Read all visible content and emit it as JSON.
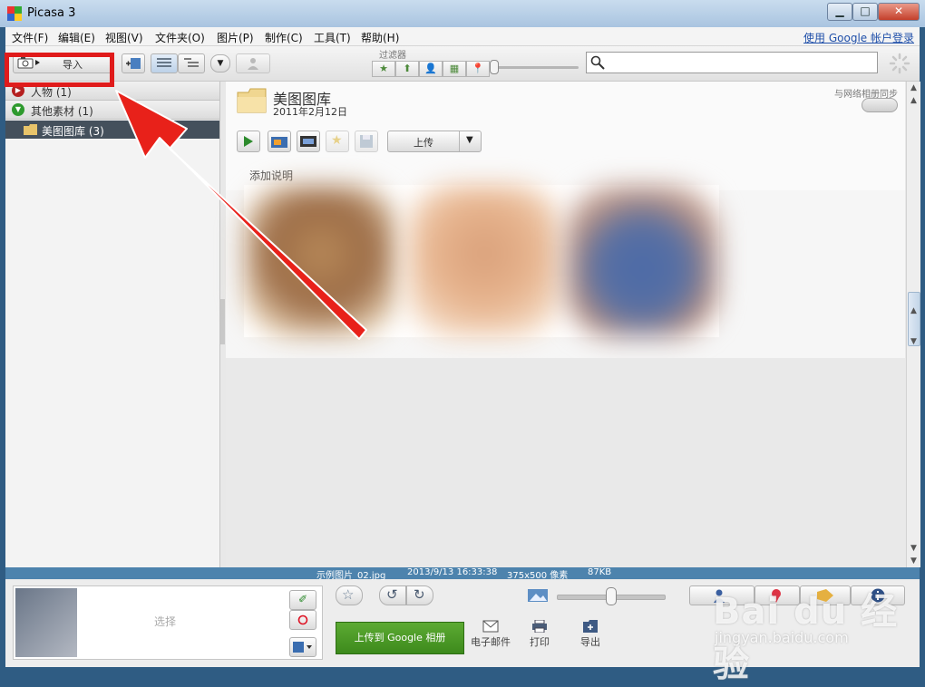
{
  "window": {
    "title": "Picasa 3",
    "minimize": "▁",
    "maximize": "□",
    "close": "✕"
  },
  "menu": {
    "items": [
      "文件(F)",
      "编辑(E)",
      "视图(V)",
      "文件夹(O)",
      "图片(P)",
      "制作(C)",
      "工具(T)",
      "帮助(H)"
    ],
    "google_login": "使用 Google 帐户登录"
  },
  "toolbar": {
    "import_label": "导入",
    "filter_label": "过滤器",
    "filters": [
      "★",
      "⬆",
      "👤",
      "▦",
      "📍"
    ],
    "search_placeholder": ""
  },
  "left_panel": {
    "groups": [
      {
        "label": "人物 (1)",
        "icon": "play-right-icon"
      },
      {
        "label": "其他素材 (1)",
        "icon": "expand-down-icon"
      }
    ],
    "selected_folder": "美图图库 (3)"
  },
  "album": {
    "title": "美图图库",
    "date": "2011年2月12日",
    "sync_label": "与网络相册同步",
    "upload_label": "上传",
    "caption_placeholder": "添加说明"
  },
  "status": {
    "filename": "示例图片_02.jpg",
    "datetime": "2013/9/13 16:33:38",
    "dimensions": "375x500 像素",
    "size": "87KB"
  },
  "tray": {
    "select_label": "选择",
    "upload_google": "上传到 Google 相册",
    "email": "电子邮件",
    "print": "打印",
    "export": "导出"
  },
  "watermark": {
    "brand": "Bai du 经验",
    "url": "jingyan.baidu.com"
  },
  "colors": {
    "highlight": "#e01b1b",
    "statusbar": "#4d83ad",
    "upload_button": "#4a9a27"
  }
}
